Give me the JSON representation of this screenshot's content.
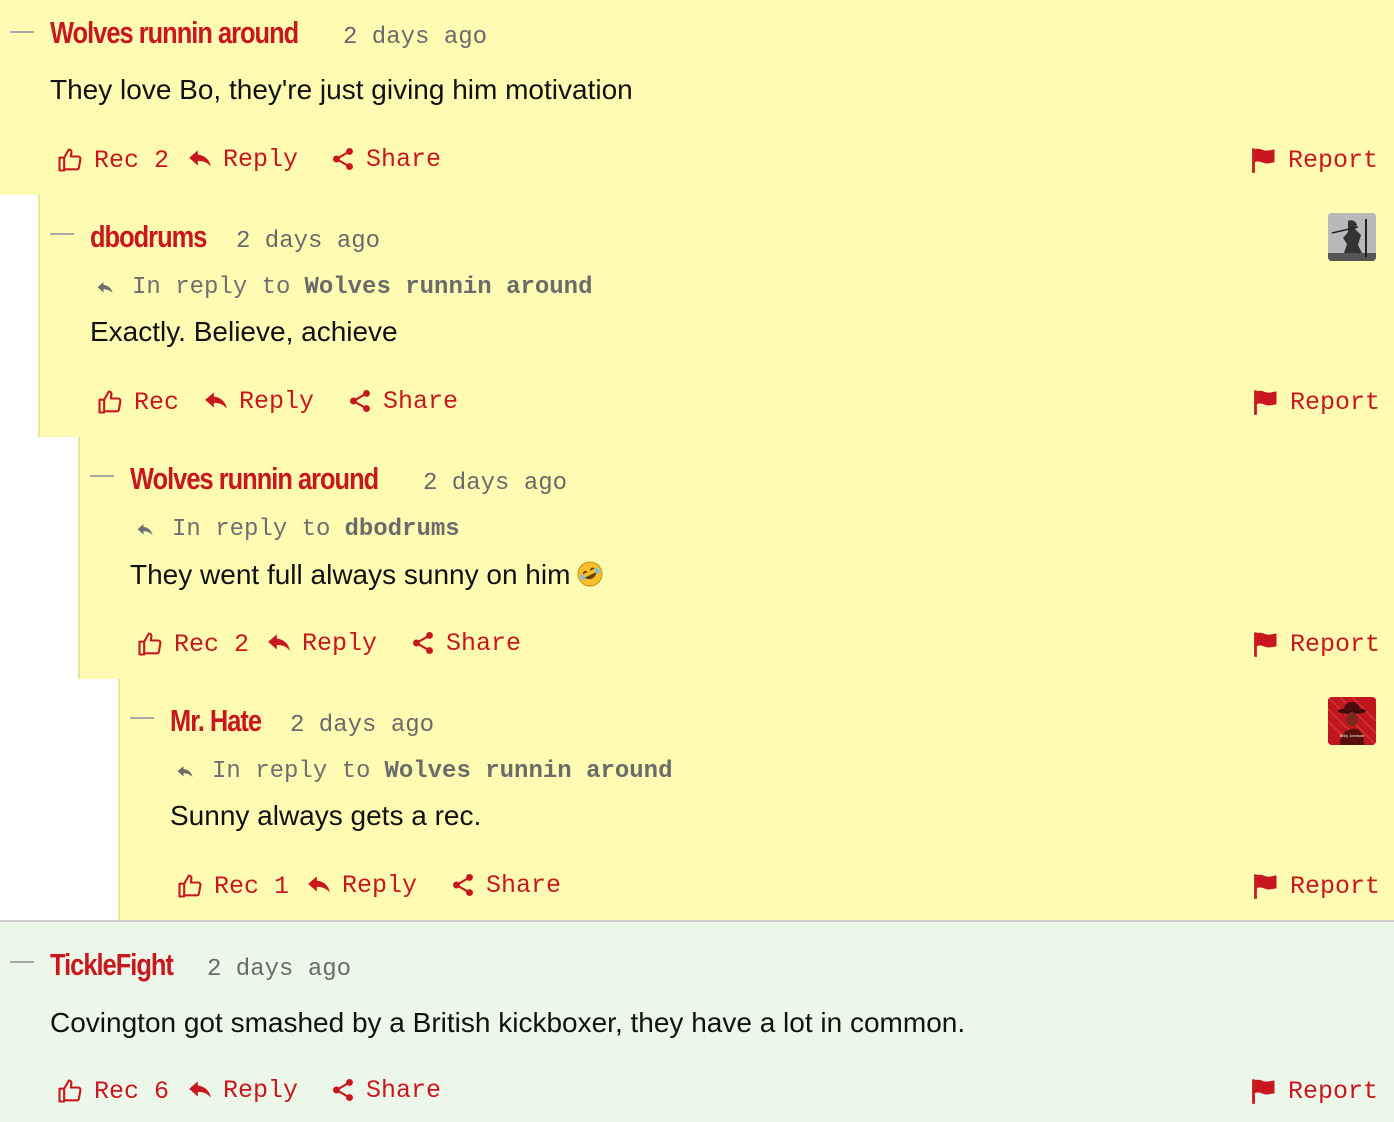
{
  "colors": {
    "accent": "#c8171e",
    "highlight_bg": "#fffbb3",
    "green_bg": "#edf7e9"
  },
  "labels": {
    "reply": "Reply",
    "share": "Share",
    "report": "Report",
    "in_reply_to": "In reply to"
  },
  "comments": [
    {
      "author": "Wolves runnin around",
      "time": "2 days ago",
      "body": "They love Bo, they're just giving him motivation",
      "rec": "Rec 2"
    },
    {
      "author": "dbodrums",
      "time": "2 days ago",
      "reply_to": "Wolves runnin around",
      "body": "Exactly. Believe, achieve",
      "rec": "Rec",
      "avatar": "armor-knight-avatar"
    },
    {
      "author": "Wolves runnin around",
      "time": "2 days ago",
      "reply_to": "dbodrums",
      "body": "They went full always sunny on him",
      "emoji": "rolling-on-floor-laughing-emoji",
      "rec": "Rec 2"
    },
    {
      "author": "Mr. Hate",
      "time": "2 days ago",
      "reply_to": "Wolves runnin around",
      "body": "Sunny always gets a rec.",
      "rec": "Rec 1",
      "avatar": "red-hat-avatar",
      "avatar_text": "Bilky Johnson"
    },
    {
      "author": "TickleFight",
      "time": "2 days ago",
      "body": "Covington got smashed by a British kickboxer, they have a lot in common.",
      "rec": "Rec 6"
    }
  ]
}
